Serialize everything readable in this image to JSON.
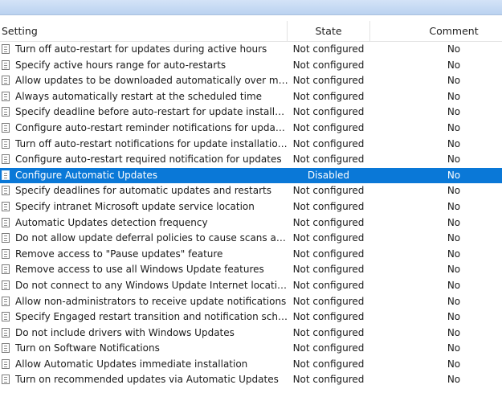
{
  "columns": {
    "setting": "Setting",
    "state": "State",
    "comment": "Comment"
  },
  "rows": [
    {
      "setting": "Turn off auto-restart for updates during active hours",
      "state": "Not configured",
      "comment": "No"
    },
    {
      "setting": "Specify active hours range for auto-restarts",
      "state": "Not configured",
      "comment": "No"
    },
    {
      "setting": "Allow updates to be downloaded automatically over metere...",
      "state": "Not configured",
      "comment": "No"
    },
    {
      "setting": "Always automatically restart at the scheduled time",
      "state": "Not configured",
      "comment": "No"
    },
    {
      "setting": "Specify deadline before auto-restart for update installation",
      "state": "Not configured",
      "comment": "No"
    },
    {
      "setting": "Configure auto-restart reminder notifications for updates",
      "state": "Not configured",
      "comment": "No"
    },
    {
      "setting": "Turn off auto-restart notifications for update installations",
      "state": "Not configured",
      "comment": "No"
    },
    {
      "setting": "Configure auto-restart required notification for updates",
      "state": "Not configured",
      "comment": "No"
    },
    {
      "setting": "Configure Automatic Updates",
      "state": "Disabled",
      "comment": "No",
      "selected": true
    },
    {
      "setting": "Specify deadlines for automatic updates and restarts",
      "state": "Not configured",
      "comment": "No"
    },
    {
      "setting": "Specify intranet Microsoft update service location",
      "state": "Not configured",
      "comment": "No"
    },
    {
      "setting": "Automatic Updates detection frequency",
      "state": "Not configured",
      "comment": "No"
    },
    {
      "setting": "Do not allow update deferral policies to cause scans against ...",
      "state": "Not configured",
      "comment": "No"
    },
    {
      "setting": "Remove access to \"Pause updates\" feature",
      "state": "Not configured",
      "comment": "No"
    },
    {
      "setting": "Remove access to use all Windows Update features",
      "state": "Not configured",
      "comment": "No"
    },
    {
      "setting": "Do not connect to any Windows Update Internet locations",
      "state": "Not configured",
      "comment": "No"
    },
    {
      "setting": "Allow non-administrators to receive update notifications",
      "state": "Not configured",
      "comment": "No"
    },
    {
      "setting": "Specify Engaged restart transition and notification schedule ...",
      "state": "Not configured",
      "comment": "No"
    },
    {
      "setting": "Do not include drivers with Windows Updates",
      "state": "Not configured",
      "comment": "No"
    },
    {
      "setting": "Turn on Software Notifications",
      "state": "Not configured",
      "comment": "No"
    },
    {
      "setting": "Allow Automatic Updates immediate installation",
      "state": "Not configured",
      "comment": "No"
    },
    {
      "setting": "Turn on recommended updates via Automatic Updates",
      "state": "Not configured",
      "comment": "No"
    }
  ],
  "row_icon": "policy-setting-icon",
  "colors": {
    "selection": "#0a78d7",
    "selection_text": "#ffffff",
    "title_bar": "#c7daf3"
  }
}
